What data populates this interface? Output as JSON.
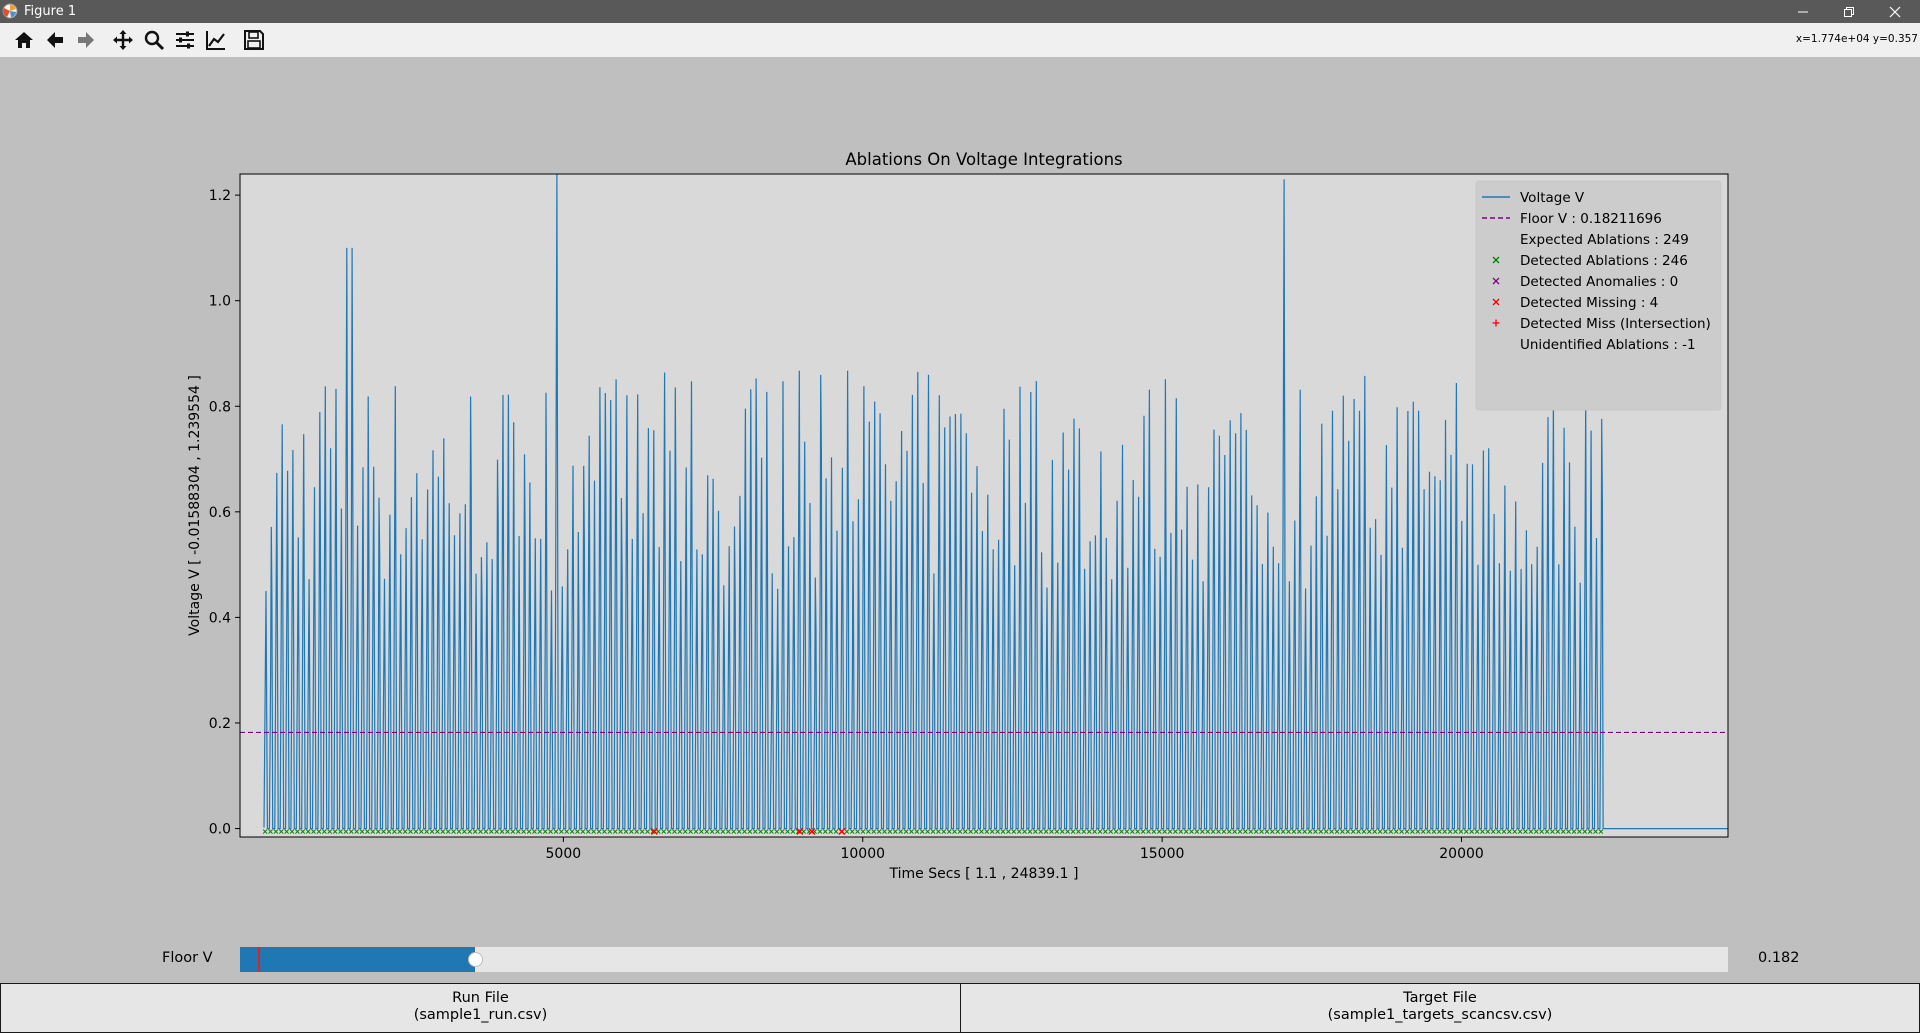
{
  "window": {
    "title": "Figure 1"
  },
  "toolbar": {
    "buttons": [
      "home-icon",
      "back-arrow-icon",
      "forward-arrow-icon",
      "pan-icon",
      "zoom-icon",
      "subplots-icon",
      "axes-edit-icon",
      "save-icon"
    ],
    "coords": "x=1.774e+04 y=0.357"
  },
  "chart_data": {
    "type": "line",
    "title": "Ablations On Voltage Integrations",
    "xlabel": "Time Secs [ 1.1 , 24839.1 ]",
    "ylabel": "Voltage V [ -0.01588304 , 1.239554 ]",
    "xlim": [
      -400,
      24450
    ],
    "ylim": [
      -0.016,
      1.24
    ],
    "xticks": [
      5000,
      10000,
      15000,
      20000
    ],
    "yticks": [
      0.0,
      0.2,
      0.4,
      0.6,
      0.8,
      1.0,
      1.2
    ],
    "grid": false,
    "signal_x_range": [
      1.1,
      22400
    ],
    "pulse_count": 249,
    "floor": 0.18211696,
    "spikes": [
      {
        "x": 1400,
        "y": 1.1
      },
      {
        "x": 4900,
        "y": 1.24
      },
      {
        "x": 17040,
        "y": 1.23
      }
    ],
    "missing_points": [
      {
        "x": 6520,
        "y": 0.0
      },
      {
        "x": 8950,
        "y": 0.0
      },
      {
        "x": 9150,
        "y": 0.0
      },
      {
        "x": 9650,
        "y": 0.0
      }
    ],
    "colors": {
      "voltage": "#1f77b4",
      "floor": "#800080",
      "detected": "#008000",
      "anomaly": "#800080",
      "missing": "#ff0000",
      "intersection": "#ff0000",
      "axes_bg": "#d9d9d9",
      "figure_bg": "#bfbfbf"
    },
    "legend": {
      "position": "upper right",
      "entries": [
        {
          "label": "Voltage V",
          "marker": "line",
          "color": "#1f77b4"
        },
        {
          "label": "Floor V : 0.18211696",
          "marker": "dashed",
          "color": "#800080"
        },
        {
          "label": "Expected Ablations : 249",
          "marker": "none",
          "color": ""
        },
        {
          "label": "Detected Ablations : 246",
          "marker": "x",
          "color": "#008000"
        },
        {
          "label": "Detected Anomalies : 0",
          "marker": "x",
          "color": "#800080"
        },
        {
          "label": "Detected Missing : 4",
          "marker": "x",
          "color": "#ff0000"
        },
        {
          "label": "Detected Miss (Intersection)",
          "marker": "+",
          "color": "#ff0000"
        },
        {
          "label": "Unidentified Ablations : -1",
          "marker": "none",
          "color": ""
        }
      ]
    }
  },
  "slider": {
    "label": "Floor V",
    "value_text": "0.182",
    "fraction": 0.158,
    "initial_fraction": 0.012
  },
  "buttons": {
    "run_file_title": "Run File",
    "run_file_name": "(sample1_run.csv)",
    "target_file_title": "Target File",
    "target_file_name": "(sample1_targets_scancsv.csv)"
  }
}
